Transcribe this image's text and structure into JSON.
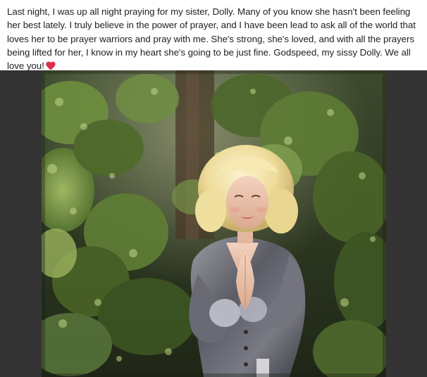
{
  "post": {
    "message": "Last night, I was up all night praying for my sister, Dolly. Many of you know she hasn't been feeling her best lately. I truly believe in the power of prayer, and I have been lead to ask all of the world that loves her to be prayer warriors and pray with me. She's strong, she's loved, and with all the prayers being lifted for her, I know in my heart she's going to be just fine. Godspeed, my sissy Dolly. We all love you!",
    "emoji": "red-heart-icon"
  },
  "media": {
    "image_subject": "photo",
    "frame_color": "#343434"
  },
  "colors": {
    "text": "#1c1e21",
    "heart": "#e0245e"
  }
}
